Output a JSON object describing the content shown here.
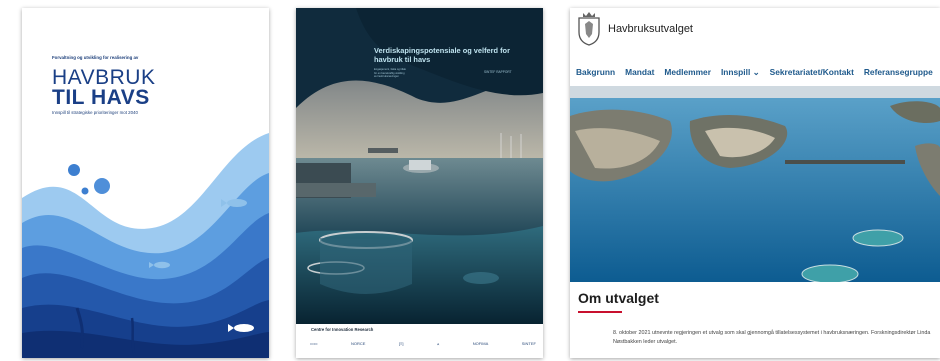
{
  "panel1": {
    "subtitle": "Forvaltning og utvikling for realisering av",
    "title_line1": "HAVBRUK",
    "title_line2": "TIL HAVS",
    "tagline": "Innspill til strategiske prioriteringer mot 2040",
    "colors": {
      "title": "#1a3f86",
      "wave_light": "#8fc1ea",
      "wave_dark": "#0f2f73"
    }
  },
  "panel2": {
    "title": "Verdiskapingspotensiale og velferd for havbruk til havs",
    "subtitle_lines": [
      "Engasjement, fakta og tiltak",
      "for en bærekraftig utvikling",
      "av havbruksnæringen"
    ],
    "tag": "SINTEF RAPPORT",
    "sponsor_heading": "Centre for Innovation Research",
    "logos": [
      "▭▭",
      "NORCE",
      "[≡]",
      "⩓",
      "NOFIMA",
      "SINTEF"
    ]
  },
  "panel3": {
    "site_title": "Havbruksutvalget",
    "nav": [
      "Bakgrunn",
      "Mandat",
      "Medlemmer",
      "Innspill ⌄",
      "Sekretariatet/Kontakt",
      "Referansegruppe"
    ],
    "page_title": "Om utvalget",
    "intro_text": "8. oktober 2021 utnevnte regjeringen et utvalg som skal gjennomgå tillatelsessystemet i havbruksnæringen. Forskningsdirektør Linda Nøstbakken leder utvalget.",
    "colors": {
      "nav": "#1f5a8c",
      "accent": "#c8102e"
    }
  }
}
